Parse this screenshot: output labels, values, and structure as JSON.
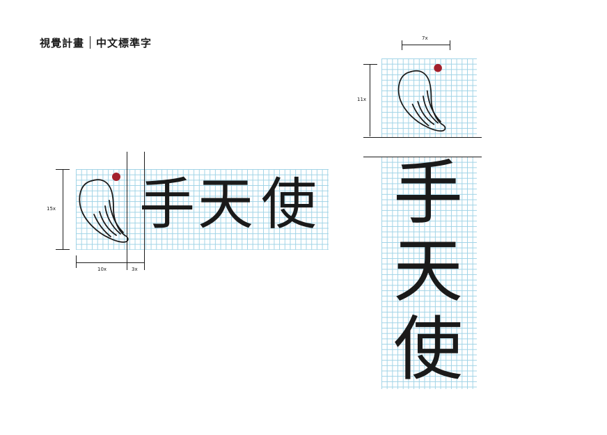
{
  "header": {
    "title": "視覺計畫",
    "subtitle": "中文標準字"
  },
  "horizontal": {
    "chars": [
      "手",
      "天",
      "使"
    ],
    "dim_height": "15x",
    "dim_wing_width": "10x",
    "dim_gap": "3x"
  },
  "vertical": {
    "chars": [
      "手",
      "天",
      "使"
    ],
    "dim_width": "7x",
    "dim_height": "11x"
  },
  "colors": {
    "grid_line": "#9fd3e6",
    "ink": "#1a1a1a",
    "dot": "#a3202c"
  },
  "icons": [
    "wing-logo-icon",
    "red-dot"
  ]
}
